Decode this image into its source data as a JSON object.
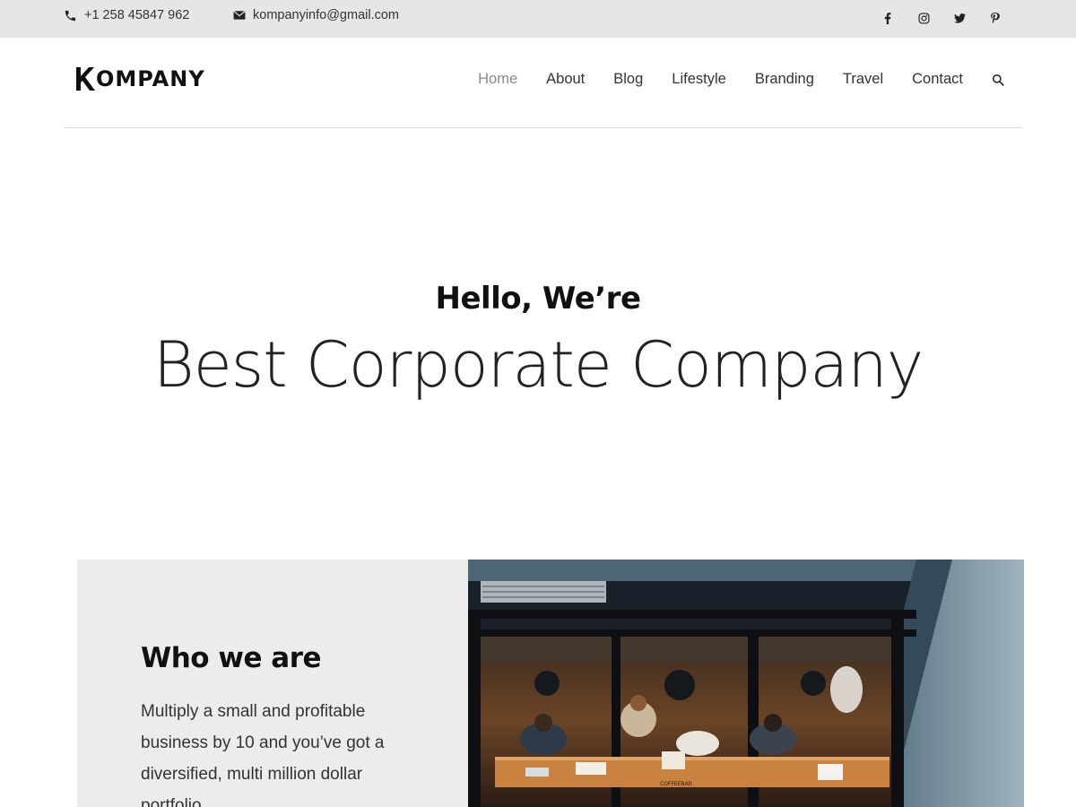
{
  "topbar": {
    "phone": "+1 258 45847 962",
    "email": "kompanyinfo@gmail.com",
    "social": [
      "facebook-icon",
      "instagram-icon",
      "twitter-icon",
      "pinterest-icon"
    ]
  },
  "header": {
    "logo": "OMPANY",
    "nav": {
      "home": "Home",
      "about": "About",
      "blog": "Blog",
      "lifestyle": "Lifestyle",
      "branding": "Branding",
      "travel": "Travel",
      "contact": "Contact"
    }
  },
  "hero": {
    "greeting": "Hello, We’re",
    "headline": "Best Corporate Company"
  },
  "about": {
    "title": "Who we are",
    "text": "Multiply a small and profitable business by 10 and you’ve got a diversified, multi million dollar portfolio"
  },
  "photo": {
    "sign": "COFFEEBAR"
  },
  "colors": {
    "topbar_bg": "#e6e6e6",
    "active_nav": "#8a8a8a",
    "about_bg": "#ececec"
  }
}
